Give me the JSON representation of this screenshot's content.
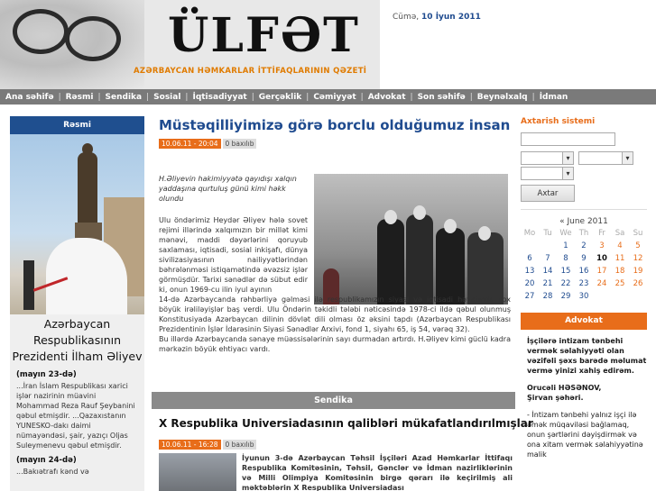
{
  "header": {
    "logo_title": "ÜLFƏT",
    "logo_subtitle": "AZƏRBAYCAN HƏMKARLAR İTTİFAQLARININ QƏZETİ",
    "date_prefix": "Cümə,",
    "date_value": "10 İyun 2011"
  },
  "nav": {
    "items": [
      "Ana səhifə",
      "Rəsmi",
      "Sendika",
      "Sosial",
      "İqtisadiyyat",
      "Gerçəklik",
      "Cəmiyyət",
      "Advokat",
      "Son səhifə",
      "Beynəlxalq",
      "İdman"
    ],
    "separator": "|"
  },
  "left": {
    "heading": "Rəsmi",
    "caption": "Azərbaycan Respublikasının Prezidenti İlham Əliyev",
    "news": [
      {
        "date": "(mayın 23-də)",
        "text": "...İran İslam Respublikası xarici işlər nazirinin müavini Mohammad Reza Rauf Şeybanini qəbul etmişdir. ...Qazaxıstanın YUNESKO-dakı daimi nümayəndəsi, şair, yazıçı Oljas Suleymenevu qəbul etmişdir."
      },
      {
        "date": "(mayın 24-də)",
        "text": "...Bakıətrafı kənd və"
      }
    ]
  },
  "article": {
    "title": "Müstəqilliyimizə görə borclu olduğumuz insan",
    "date": "10.06.11 - 20:04",
    "views": "0 baxılıb",
    "lead": "H.Əliyevin hakimiyyətə qayıdışı xalqın yaddaşına qurtuluş günü kimi həkk olundu",
    "para1": "Ulu öndərimiz Heydər Əliyev hələ sovet rejimi illərində xalqımızın bir millət kimi mənəvi, maddi dəyərlərini qoruyub saxlaması, iqtisadi, sosial inkişafı, dünya sivilizasiyasının nailiyyətlərindən bəhrələnməsi istiqamətində əvəzsiz işlər görmüşdür. Tarixi sənədlər də sübut edir ki, onun 1969-cu ilin iyul ayının",
    "para2": "14-də Azərbaycanda rəhbərliyə gəlməsi ilə respublikamızın siyasi və iqtisadi həyatında çox böyük irəliləyişlər baş verdi. Ulu Öndərin təkidli tələbi nəticəsində 1978-ci ildə qəbul olunmuş Konstitusiyada Azərbaycan dilinin dövlət dili olması öz əksini tapdı (Azərbaycan Respublikası Prezidentinin İşlər İdarəsinin Siyasi Sənədlər Arxivi, fond 1, siyahı 65, iş 54, vərəq 32).",
    "para3": "Bu illərdə Azərbaycanda sənaye müəssisələrinin sayı durmadan artırdı. H.Əliyev kimi güclü kadra mərkəzin böyük ehtiyacı vardı."
  },
  "section2": {
    "heading": "Sendika",
    "title": "X Respublika Universiadasının qalibləri mükafatlandırılmışlar",
    "date": "10.06.11 - 16:28",
    "views": "0 baxılıb",
    "text": "İyunun 3-də Azərbaycan Təhsil İşçiləri Azad Həmkarlar İttifaqı Respublika Komitəsinin, Təhsil, Gənclər və İdman nazirliklərinin və Milli Olimpiya Komitəsinin birgə qərarı ilə keçirilmiş ali məktəblərin X Respublika Universiadası"
  },
  "right": {
    "search_heading": "Axtarish sistemi",
    "search_button": "Axtar",
    "calendar": {
      "title": "« June 2011",
      "weekdays": [
        "Mo",
        "Tu",
        "We",
        "Th",
        "Fr",
        "Sa",
        "Su"
      ],
      "days": [
        "",
        "",
        "1",
        "2",
        "3",
        "4",
        "5",
        "6",
        "7",
        "8",
        "9",
        "10",
        "11",
        "12",
        "13",
        "14",
        "15",
        "16",
        "17",
        "18",
        "19",
        "20",
        "21",
        "22",
        "23",
        "24",
        "25",
        "26",
        "27",
        "28",
        "29",
        "30"
      ],
      "today": "10"
    },
    "advokat_heading": "Advokat",
    "advokat_question": "İşçilərə intizam tənbehi vermək səlahiyyəti olan vəzifəli şəxs barədə məlumat vermə yinizi xahiş edirəm.",
    "advokat_author": "Orucəli HƏSƏNOV,",
    "advokat_city": "Şirvan şəhəri.",
    "advokat_answer": "- İntizam tənbehi yalnız işçi ilə əmək müqaviləsi bağlamaq, onun şərtlərini dəyişdirmək və ona xitam vermək səlahiyyətinə malik"
  },
  "colors": {
    "accent_orange": "#e86d1a",
    "brand_blue": "#1f4b8f",
    "nav_gray": "#7a7a7a"
  }
}
